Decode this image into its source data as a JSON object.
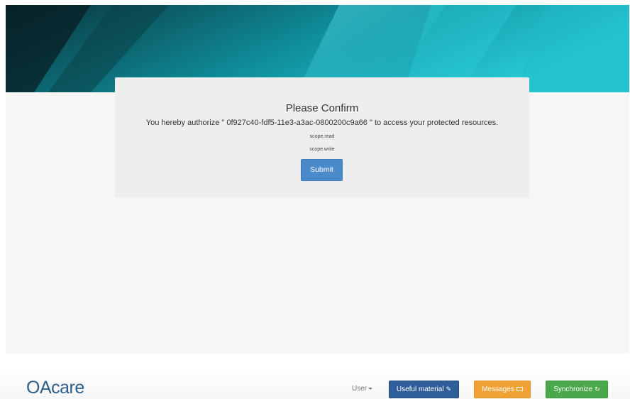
{
  "confirm": {
    "title": "Please Confirm",
    "authorize_text": "You hereby authorize \" 0f927c40-fdf5-11e3-a3ac-0800200c9a66 \" to access your protected resources.",
    "scopes": [
      "scope.read",
      "scope.write"
    ],
    "submit_label": "Submit"
  },
  "footer": {
    "logo": "OAcare",
    "user_menu_label": "User",
    "useful_material_label": "Useful material",
    "messages_label": "Messages",
    "synchronize_label": "Synchronize"
  },
  "icons": {
    "useful_material": "paperclip-icon",
    "messages": "envelope-icon",
    "synchronize": "refresh-icon",
    "user_menu": "caret-down-icon"
  },
  "colors": {
    "banner_dark": "#0b3b44",
    "banner_teal": "#1fc0cf",
    "submit": "#4a8acb",
    "useful_material": "#2e5f9a",
    "messages": "#f0a234",
    "synchronize": "#4aa84a",
    "logo": "#2d5f8e"
  }
}
